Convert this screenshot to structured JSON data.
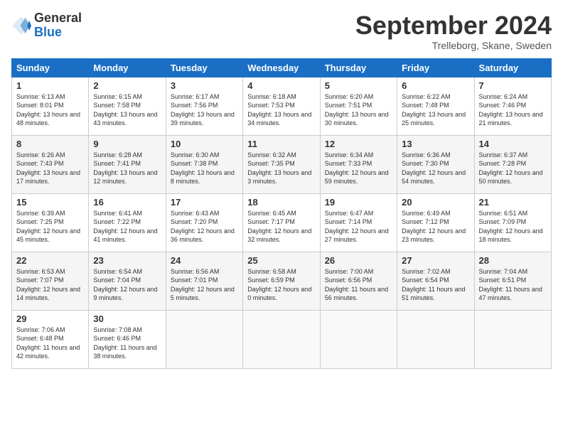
{
  "logo": {
    "general": "General",
    "blue": "Blue"
  },
  "title": "September 2024",
  "subtitle": "Trelleborg, Skane, Sweden",
  "days_of_week": [
    "Sunday",
    "Monday",
    "Tuesday",
    "Wednesday",
    "Thursday",
    "Friday",
    "Saturday"
  ],
  "weeks": [
    [
      {
        "day": "1",
        "sunrise": "6:13 AM",
        "sunset": "8:01 PM",
        "daylight": "13 hours and 48 minutes."
      },
      {
        "day": "2",
        "sunrise": "6:15 AM",
        "sunset": "7:58 PM",
        "daylight": "13 hours and 43 minutes."
      },
      {
        "day": "3",
        "sunrise": "6:17 AM",
        "sunset": "7:56 PM",
        "daylight": "13 hours and 39 minutes."
      },
      {
        "day": "4",
        "sunrise": "6:18 AM",
        "sunset": "7:53 PM",
        "daylight": "13 hours and 34 minutes."
      },
      {
        "day": "5",
        "sunrise": "6:20 AM",
        "sunset": "7:51 PM",
        "daylight": "13 hours and 30 minutes."
      },
      {
        "day": "6",
        "sunrise": "6:22 AM",
        "sunset": "7:48 PM",
        "daylight": "13 hours and 25 minutes."
      },
      {
        "day": "7",
        "sunrise": "6:24 AM",
        "sunset": "7:46 PM",
        "daylight": "13 hours and 21 minutes."
      }
    ],
    [
      {
        "day": "8",
        "sunrise": "6:26 AM",
        "sunset": "7:43 PM",
        "daylight": "13 hours and 17 minutes."
      },
      {
        "day": "9",
        "sunrise": "6:28 AM",
        "sunset": "7:41 PM",
        "daylight": "13 hours and 12 minutes."
      },
      {
        "day": "10",
        "sunrise": "6:30 AM",
        "sunset": "7:38 PM",
        "daylight": "13 hours and 8 minutes."
      },
      {
        "day": "11",
        "sunrise": "6:32 AM",
        "sunset": "7:35 PM",
        "daylight": "13 hours and 3 minutes."
      },
      {
        "day": "12",
        "sunrise": "6:34 AM",
        "sunset": "7:33 PM",
        "daylight": "12 hours and 59 minutes."
      },
      {
        "day": "13",
        "sunrise": "6:36 AM",
        "sunset": "7:30 PM",
        "daylight": "12 hours and 54 minutes."
      },
      {
        "day": "14",
        "sunrise": "6:37 AM",
        "sunset": "7:28 PM",
        "daylight": "12 hours and 50 minutes."
      }
    ],
    [
      {
        "day": "15",
        "sunrise": "6:39 AM",
        "sunset": "7:25 PM",
        "daylight": "12 hours and 45 minutes."
      },
      {
        "day": "16",
        "sunrise": "6:41 AM",
        "sunset": "7:22 PM",
        "daylight": "12 hours and 41 minutes."
      },
      {
        "day": "17",
        "sunrise": "6:43 AM",
        "sunset": "7:20 PM",
        "daylight": "12 hours and 36 minutes."
      },
      {
        "day": "18",
        "sunrise": "6:45 AM",
        "sunset": "7:17 PM",
        "daylight": "12 hours and 32 minutes."
      },
      {
        "day": "19",
        "sunrise": "6:47 AM",
        "sunset": "7:14 PM",
        "daylight": "12 hours and 27 minutes."
      },
      {
        "day": "20",
        "sunrise": "6:49 AM",
        "sunset": "7:12 PM",
        "daylight": "12 hours and 23 minutes."
      },
      {
        "day": "21",
        "sunrise": "6:51 AM",
        "sunset": "7:09 PM",
        "daylight": "12 hours and 18 minutes."
      }
    ],
    [
      {
        "day": "22",
        "sunrise": "6:53 AM",
        "sunset": "7:07 PM",
        "daylight": "12 hours and 14 minutes."
      },
      {
        "day": "23",
        "sunrise": "6:54 AM",
        "sunset": "7:04 PM",
        "daylight": "12 hours and 9 minutes."
      },
      {
        "day": "24",
        "sunrise": "6:56 AM",
        "sunset": "7:01 PM",
        "daylight": "12 hours and 5 minutes."
      },
      {
        "day": "25",
        "sunrise": "6:58 AM",
        "sunset": "6:59 PM",
        "daylight": "12 hours and 0 minutes."
      },
      {
        "day": "26",
        "sunrise": "7:00 AM",
        "sunset": "6:56 PM",
        "daylight": "11 hours and 56 minutes."
      },
      {
        "day": "27",
        "sunrise": "7:02 AM",
        "sunset": "6:54 PM",
        "daylight": "11 hours and 51 minutes."
      },
      {
        "day": "28",
        "sunrise": "7:04 AM",
        "sunset": "6:51 PM",
        "daylight": "11 hours and 47 minutes."
      }
    ],
    [
      {
        "day": "29",
        "sunrise": "7:06 AM",
        "sunset": "6:48 PM",
        "daylight": "11 hours and 42 minutes."
      },
      {
        "day": "30",
        "sunrise": "7:08 AM",
        "sunset": "6:46 PM",
        "daylight": "11 hours and 38 minutes."
      },
      null,
      null,
      null,
      null,
      null
    ]
  ]
}
